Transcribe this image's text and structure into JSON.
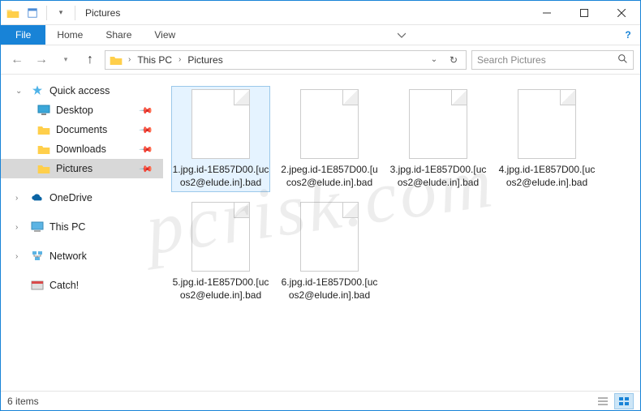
{
  "window": {
    "title": "Pictures"
  },
  "ribbon": {
    "file": "File",
    "tabs": [
      "Home",
      "Share",
      "View"
    ]
  },
  "breadcrumb": {
    "segments": [
      "This PC",
      "Pictures"
    ]
  },
  "search": {
    "placeholder": "Search Pictures"
  },
  "nav": {
    "quick_access": "Quick access",
    "items": [
      "Desktop",
      "Documents",
      "Downloads",
      "Pictures"
    ],
    "onedrive": "OneDrive",
    "thispc": "This PC",
    "network": "Network",
    "catch": "Catch!"
  },
  "files": [
    "1.jpg.id-1E857D00.[ucos2@elude.in].bad",
    "2.jpeg.id-1E857D00.[ucos2@elude.in].bad",
    "3.jpg.id-1E857D00.[ucos2@elude.in].bad",
    "4.jpg.id-1E857D00.[ucos2@elude.in].bad",
    "5.jpg.id-1E857D00.[ucos2@elude.in].bad",
    "6.jpg.id-1E857D00.[ucos2@elude.in].bad"
  ],
  "status": {
    "count": "6 items"
  },
  "watermark": "pcrisk.com"
}
